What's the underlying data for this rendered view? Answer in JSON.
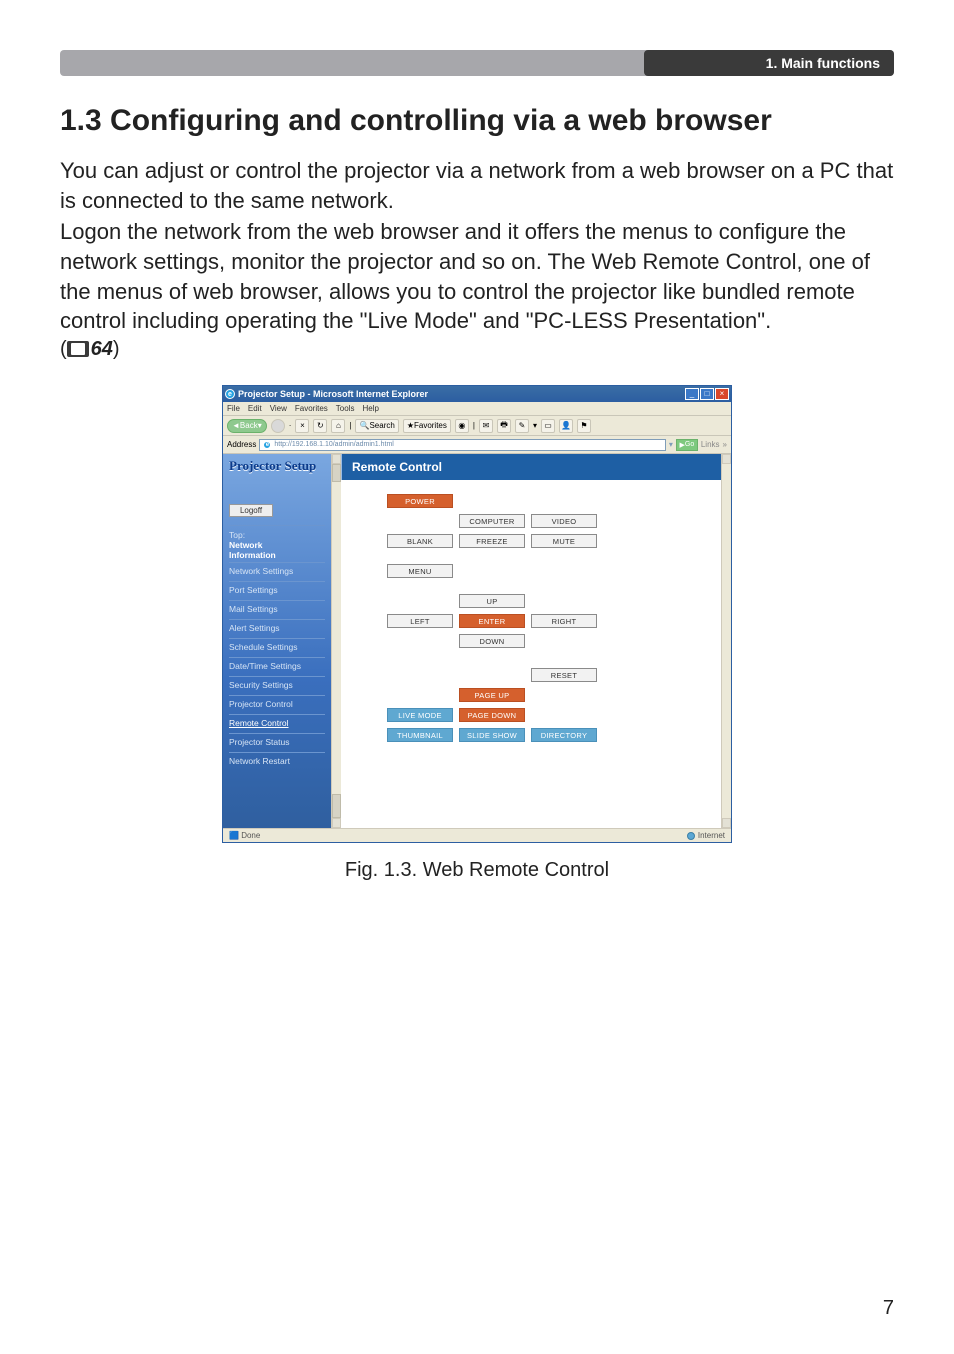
{
  "header": {
    "chapter": "1. Main functions"
  },
  "section": {
    "title": "1.3 Configuring and controlling via a web browser",
    "p1": "You can adjust or control the projector via a network from a web browser on a PC that is connected to the same network.",
    "p2": "Logon the network from the web browser and it offers the menus to configure the network settings, monitor the projector and so on. The Web Remote Control, one of the menus of web browser, allows you to control the projector like bundled remote control including operating the \"Live Mode\" and \"PC-LESS Presentation\".",
    "ref_num": "64"
  },
  "figure": {
    "caption": "Fig. 1.3. Web Remote Control"
  },
  "page_number": "7",
  "ie": {
    "title": "Projector Setup - Microsoft Internet Explorer",
    "menus": [
      "File",
      "Edit",
      "View",
      "Favorites",
      "Tools",
      "Help"
    ],
    "toolbar": {
      "back": "Back",
      "search": "Search",
      "favorites": "Favorites"
    },
    "address_label": "Address",
    "address": "http://192.168.1.10/admin/admin1.html",
    "go": "Go",
    "links": "Links",
    "status_left": "Done",
    "status_right": "Internet"
  },
  "sidebar": {
    "app_title": "Projector Setup",
    "logoff": "Logoff",
    "top_label": "Top:",
    "top_line1": "Network",
    "top_line2": "Information",
    "items": [
      "Network Settings",
      "Port Settings",
      "Mail Settings",
      "Alert Settings",
      "Schedule Settings",
      "Date/Time Settings",
      "Security Settings",
      "Projector Control",
      "Remote Control",
      "Projector Status",
      "Network Restart"
    ],
    "selected_index": 8
  },
  "panel": {
    "title": "Remote Control",
    "buttons": {
      "power": "POWER",
      "computer": "COMPUTER",
      "video": "VIDEO",
      "blank": "BLANK",
      "freeze": "FREEZE",
      "mute": "MUTE",
      "menu": "MENU",
      "up": "UP",
      "left": "LEFT",
      "enter": "ENTER",
      "right": "RIGHT",
      "down": "DOWN",
      "reset": "RESET",
      "page_up": "PAGE UP",
      "live_mode": "LIVE MODE",
      "page_down": "PAGE DOWN",
      "thumbnail": "THUMBNAIL",
      "slide_show": "SLIDE SHOW",
      "directory": "DIRECTORY"
    }
  }
}
